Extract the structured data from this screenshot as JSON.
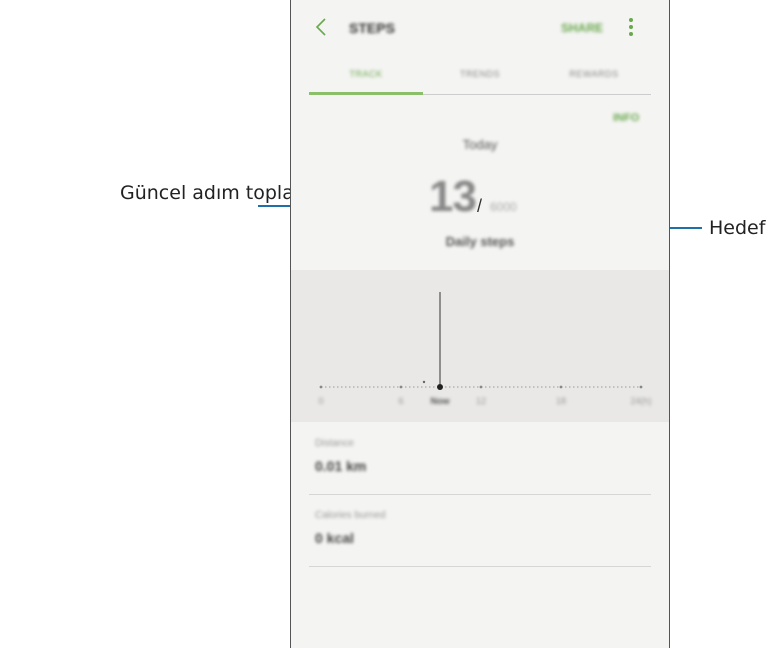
{
  "callouts": {
    "current_steps": "Güncel adım toplamı",
    "goal": "Hedef"
  },
  "app_bar": {
    "title": "STEPS",
    "share_label": "SHARE"
  },
  "tabs": [
    {
      "label": "TRACK",
      "active": true
    },
    {
      "label": "TRENDS",
      "active": false
    },
    {
      "label": "REWARDS",
      "active": false
    }
  ],
  "info_label": "INFO",
  "today_label": "Today",
  "steps": {
    "count": "13",
    "separator": "/",
    "goal": "6000",
    "label": "Daily steps"
  },
  "chart_data": {
    "type": "line",
    "x_ticks": [
      "0",
      "6",
      "Now",
      "12",
      "18",
      "24(h)"
    ],
    "current_marker": "Now"
  },
  "stats": [
    {
      "label": "Distance",
      "value": "0.01 km"
    },
    {
      "label": "Calories burned",
      "value": "0 kcal"
    }
  ],
  "colors": {
    "accent": "#6aa84f",
    "callout_line": "#1f6fa8"
  }
}
